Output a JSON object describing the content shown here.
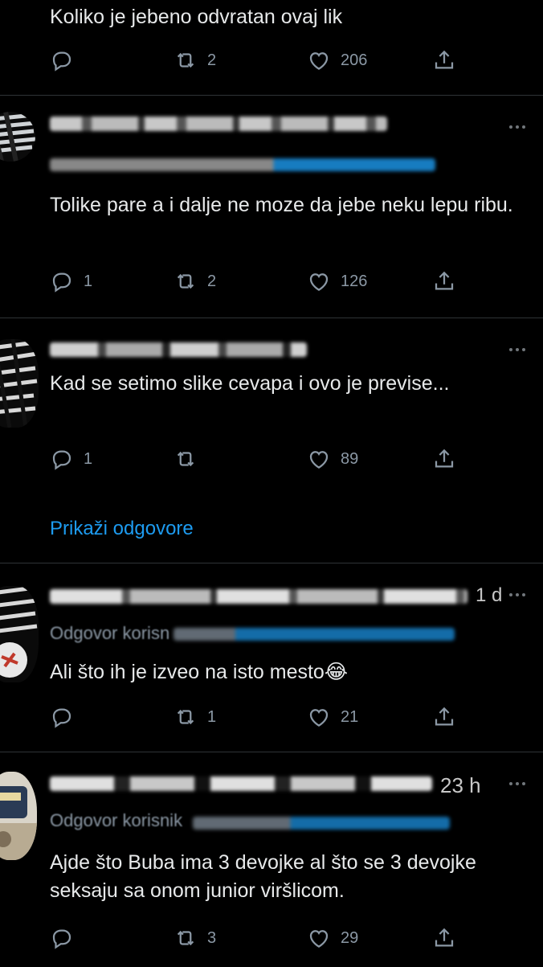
{
  "tweets": [
    {
      "text": "Koliko je jebeno odvratan ovaj lik",
      "counts": {
        "reply": "",
        "retweet": "2",
        "like": "206"
      }
    },
    {
      "text": "Tolike pare a i dalje ne moze da jebe neku lepu ribu.",
      "counts": {
        "reply": "1",
        "retweet": "2",
        "like": "126"
      }
    },
    {
      "text": "Kad se setimo slike cevapa i ovo je previse...",
      "counts": {
        "reply": "1",
        "retweet": "",
        "like": "89"
      }
    },
    {
      "handle_fragment": "1 d",
      "reply_prefix": "Odgovor korisn",
      "text": "Ali što ih je izveo na isto mesto😂",
      "counts": {
        "reply": "",
        "retweet": "1",
        "like": "21"
      }
    },
    {
      "handle_fragment": "23 h",
      "reply_prefix": "Odgovor korisnik",
      "text": "Ajde što Buba ima 3 devojke al što se 3 devojke seksaju sa onom junior viršlicom.",
      "counts": {
        "reply": "",
        "retweet": "3",
        "like": "29"
      }
    }
  ],
  "show_replies": "Prikaži odgovore",
  "icons": {
    "reply": "reply-icon",
    "retweet": "retweet-icon",
    "like": "heart-icon",
    "share": "share-icon",
    "more": "more-icon"
  },
  "colors": {
    "background": "#000000",
    "text": "#e7e9ea",
    "muted": "#8b98a5",
    "link": "#1d9bf0",
    "divider": "#2f3336"
  }
}
